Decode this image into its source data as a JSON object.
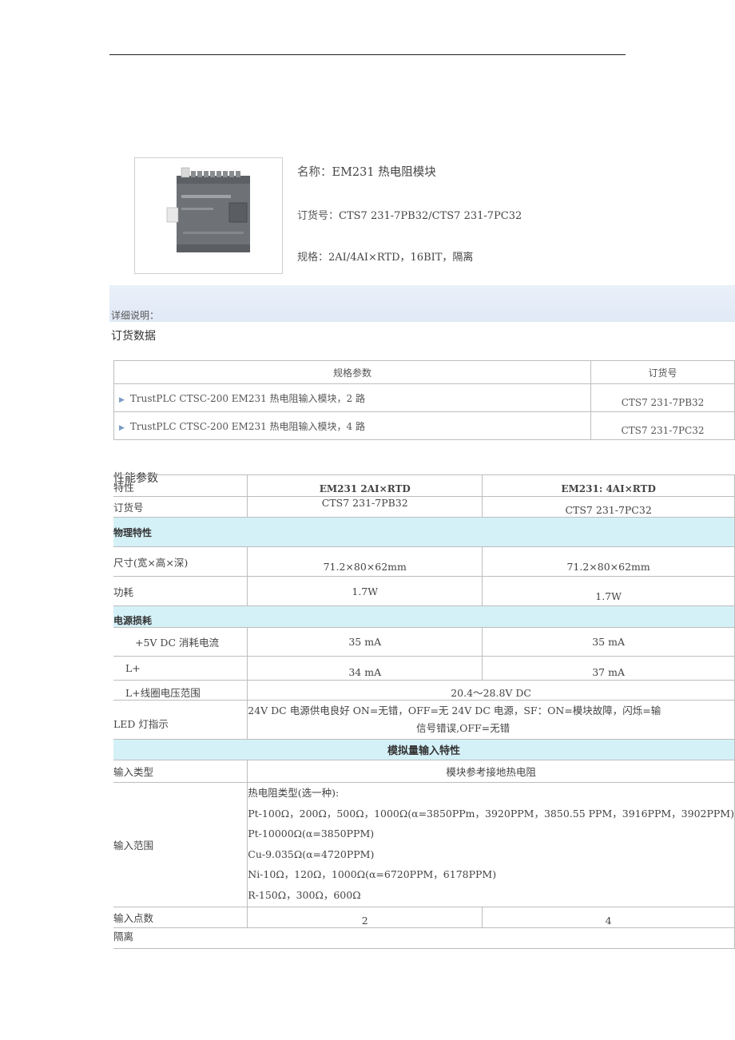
{
  "product": {
    "name_label": "名称：",
    "name_value": "EM231 热电阻模块",
    "order_label": "订货号：",
    "order_value": "CTS7 231-7PB32/CTS7 231-7PC32",
    "spec_label": "规格：",
    "spec_value": "2AI/4AI×RTD，16BIT，隔离"
  },
  "detail_label": "详细说明：",
  "order_data": {
    "title": "订货数据",
    "headers": [
      "规格参数",
      "订货号"
    ],
    "rows": [
      {
        "spec": "TrustPLC CTSC-200 EM231 热电阻输入模块，2 路",
        "order": "CTS7 231-7PB32"
      },
      {
        "spec": "TrustPLC CTSC-200 EM231 热电阻输入模块，4 路",
        "order": "CTS7 231-7PC32"
      }
    ]
  },
  "perf": {
    "title": "性能参数",
    "headers": [
      "特性",
      "EM231 2AI×RTD",
      "EM231: 4AI×RTD"
    ],
    "order_row": {
      "label": "订货号",
      "v1": "CTS7 231-7PB32",
      "v2": "CTS7 231-7PC32"
    },
    "sec_physical": "物理特性",
    "size": {
      "label": "尺寸(宽×高×深)",
      "v1": "71.2×80×62mm",
      "v2": "71.2×80×62mm"
    },
    "power": {
      "label": "功耗",
      "v1": "1.7W",
      "v2": "1.7W"
    },
    "sec_power_loss": "电源损耗",
    "current_5v": {
      "label": "+5V DC 消耗电流",
      "v1": "35  mA",
      "v2": "35  mA"
    },
    "lplus": {
      "label": "L+",
      "v1": "34 mA",
      "v2": "37 mA"
    },
    "lplus_range": {
      "label": "L+线圈电压范围",
      "value": "20.4～28.8V DC"
    },
    "led": {
      "label": "LED 灯指示",
      "line1": "24V DC 电源供电良好 ON=无错，OFF=无 24V DC 电源，SF：ON=模块故障，闪烁=输",
      "line2": "信号错误,OFF=无错"
    },
    "sec_analog": "模拟量输入特性",
    "input_type": {
      "label": "输入类型",
      "value": "模块参考接地热电阻"
    },
    "input_range": {
      "label": "输入范围",
      "lines": [
        "热电阻类型(选一种):",
        "Pt-100Ω，200Ω，500Ω，1000Ω(α=3850PPm，3920PPM，3850.55 PPM，3916PPM，3902PPM)",
        "Pt-10000Ω(α=3850PPM)",
        "Cu-9.035Ω(α=4720PPM)",
        "Ni-10Ω，120Ω，1000Ω(α=6720PPM，6178PPM)",
        "R-150Ω，300Ω，600Ω"
      ]
    },
    "input_points": {
      "label": "输入点数",
      "v1": "2",
      "v2": "4"
    },
    "isolation": {
      "label": "隔离"
    }
  }
}
